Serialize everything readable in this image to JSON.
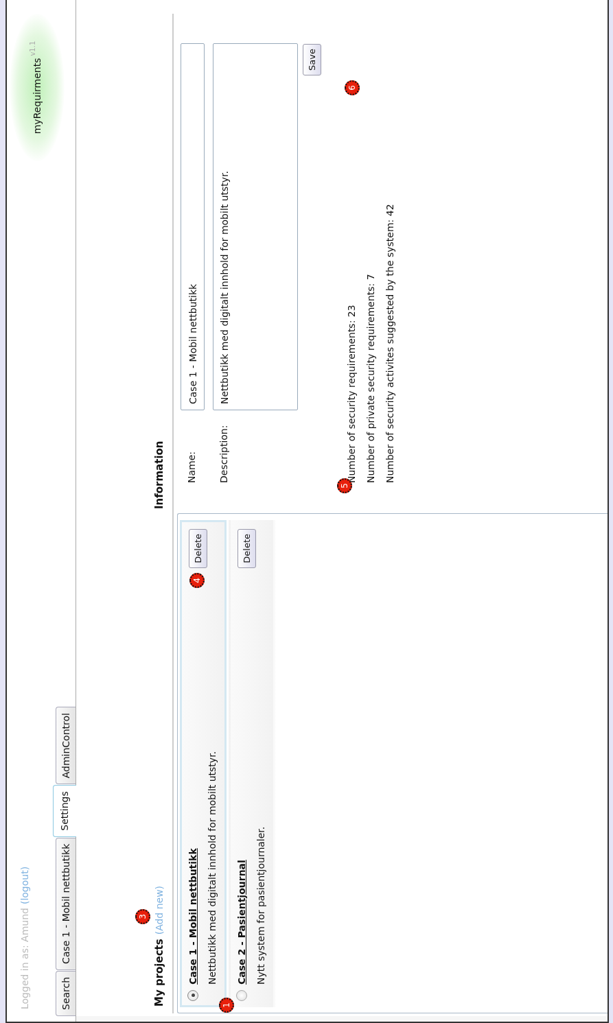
{
  "header": {
    "logged_in_text": "Logged in as: Amund",
    "logout_link": "(logout)",
    "logo": "myRequirments",
    "version": "v1.1"
  },
  "tabs": [
    {
      "label": "Search",
      "selected": false
    },
    {
      "label": "Case 1 - Mobil nettbutikk",
      "selected": false
    },
    {
      "label": "Settings",
      "selected": true
    },
    {
      "label": "AdminControl",
      "selected": false
    }
  ],
  "projects": {
    "heading": "My projects",
    "add_link": "(Add new)",
    "items": [
      {
        "title": "Case 1 - Mobil nettbutikk",
        "description": "Nettbutikk med digitalt innhold for mobilt utstyr.",
        "selected": true,
        "delete_label": "Delete"
      },
      {
        "title": "Case 2 - Pasientjournal",
        "description": "Nytt system for pasientjournaler.",
        "selected": false,
        "delete_label": "Delete"
      }
    ]
  },
  "information": {
    "heading": "Information",
    "name_label": "Name:",
    "name_value": "Case 1 - Mobil nettbutikk",
    "description_label": "Description:",
    "description_value": "Nettbutikk med digitalt innhold for mobilt utstyr.",
    "save_label": "Save",
    "stats": [
      "Number of security requirements: 23",
      "Number of private security requirements: 7",
      "Number of security activites suggested by the system: 42"
    ]
  },
  "markers": [
    {
      "label": "1"
    },
    {
      "label": "3"
    },
    {
      "label": "4"
    },
    {
      "label": "5"
    },
    {
      "label": "6"
    }
  ]
}
